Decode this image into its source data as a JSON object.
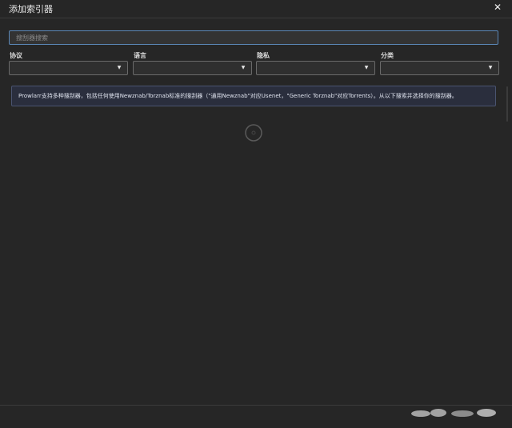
{
  "window": {
    "title": "添加索引器",
    "close_icon": "close-icon"
  },
  "search": {
    "placeholder": "搜刮器搜索",
    "value": ""
  },
  "filters": [
    {
      "label": "协议",
      "selected": ""
    },
    {
      "label": "语言",
      "selected": ""
    },
    {
      "label": "隐私",
      "selected": ""
    },
    {
      "label": "分类",
      "selected": ""
    }
  ],
  "info": {
    "text": "Prowlarr支持多种搜刮器，包括任何使用Newznab/Torznab标准的搜刮器（\"通用Newznab\"对应Usenet，\"Generic Torznab\"对应Torrents）。从以下搜索并选择你的搜刮器。"
  },
  "loading": {
    "spinner_icon": "spinner-icon"
  },
  "colors": {
    "background": "#262626",
    "accent": "#5b87b7",
    "info_bg": "#2a2e3d"
  }
}
